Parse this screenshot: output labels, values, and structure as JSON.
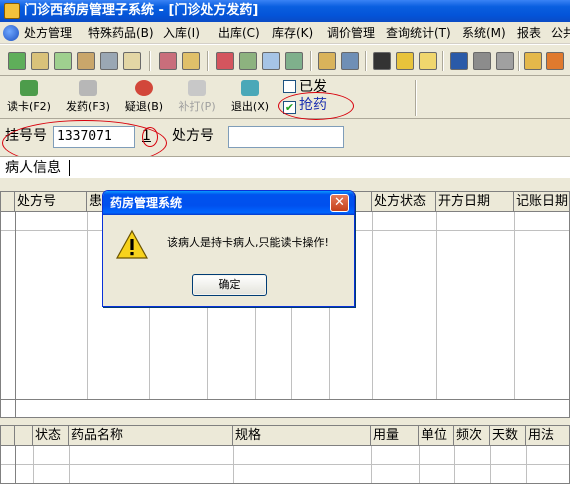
{
  "window": {
    "title": "门诊西药房管理子系统 - [门诊处方发药]"
  },
  "menu": {
    "items": [
      {
        "label": "处方管理"
      },
      {
        "label": "特殊药品(B)"
      },
      {
        "label": "入库(I)"
      },
      {
        "label": "出库(C)"
      },
      {
        "label": "库存(K)"
      },
      {
        "label": "调价管理"
      },
      {
        "label": "查询统计(T)"
      },
      {
        "label": "系统(M)"
      },
      {
        "label": "报表"
      },
      {
        "label": "公共"
      }
    ]
  },
  "toolbar": {
    "read_card": "读卡(F2)",
    "dispense": "发药(F3)",
    "query_return": "疑退(B)",
    "reprint": "补打(P)",
    "exit": "退出(X)"
  },
  "options": {
    "dispensed_label": "已发",
    "dispensed_checked": false,
    "grab_label": "抢药",
    "grab_checked": true,
    "check_mark": "✔"
  },
  "form": {
    "reg_no_label": "挂号号",
    "reg_no_value": "1337071",
    "count_value": "1",
    "rx_no_label": "处方号",
    "rx_no_value": "",
    "patient_info_label": "病人信息"
  },
  "rx_table": {
    "columns": [
      "处方号",
      "患",
      "",
      "",
      "",
      "",
      "",
      "处方状态",
      "开方日期",
      "记账日期"
    ]
  },
  "drug_table": {
    "columns": [
      "",
      "状态",
      "药品名称",
      "规格",
      "用量",
      "单位",
      "频次",
      "天数",
      "用法"
    ]
  },
  "dialog": {
    "title": "药房管理系统",
    "message": "该病人是持卡病人,只能读卡操作!",
    "ok_label": "确定",
    "close_glyph": "✕"
  },
  "colors": {
    "title_blue": "#0454d8",
    "annotation_red": "#d8000c",
    "window_bg": "#ece9d8"
  }
}
